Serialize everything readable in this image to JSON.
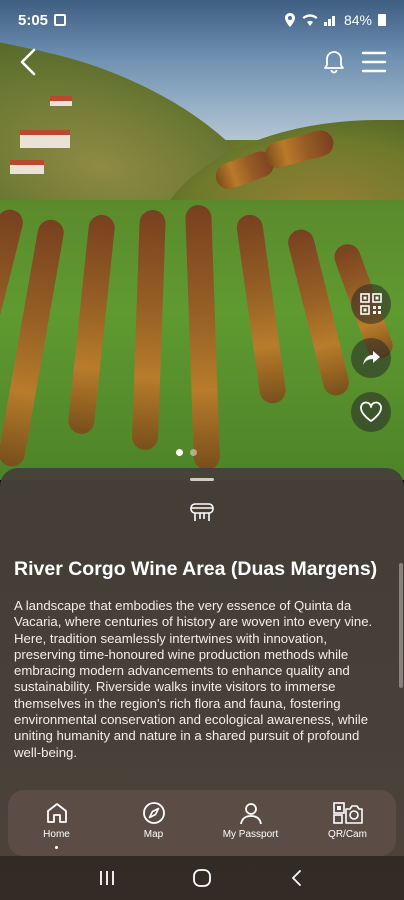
{
  "status_bar": {
    "time": "5:05",
    "battery": "84%"
  },
  "top_bar": {
    "back_icon": "chevron-left-icon",
    "notifications_icon": "bell-icon",
    "menu_icon": "hamburger-icon"
  },
  "side_actions": {
    "qr_icon": "qr-code-icon",
    "share_icon": "share-icon",
    "favorite_icon": "heart-icon"
  },
  "gallery": {
    "active_index": 0,
    "count": 2
  },
  "sheet": {
    "category_icon": "grill-icon",
    "title": "River Corgo Wine Area (Duas Margens)",
    "description": "A landscape that embodies the very essence of Quinta da Vacaria, where centuries of history are woven into every vine. Here, tradition seamlessly intertwines with innovation, preserving time-honoured wine production methods while embracing modern advancements to enhance quality and sustainability. Riverside walks invite visitors to immerse themselves in the region's rich flora and fauna, fostering environmental conservation and ecological awareness, while uniting humanity and nature in a shared pursuit of profound well-being."
  },
  "bottom_nav": {
    "items": [
      {
        "label": "Home",
        "icon": "home-icon",
        "active": true
      },
      {
        "label": "Map",
        "icon": "compass-icon",
        "active": false
      },
      {
        "label": "My Passport",
        "icon": "user-icon",
        "active": false
      },
      {
        "label": "QR/Cam",
        "icon": "qr-camera-icon",
        "active": false
      }
    ]
  },
  "system_nav": {
    "recents_icon": "recents-icon",
    "home_icon": "circle-home-icon",
    "back_icon": "system-back-icon"
  },
  "colors": {
    "sheet_bg": "#48413a",
    "nav_bg": "#5c4e46",
    "text": "#ffffff"
  }
}
